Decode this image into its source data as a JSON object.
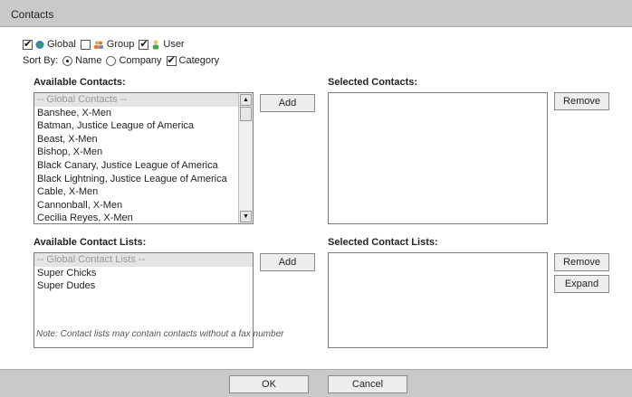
{
  "window": {
    "title": "Contacts"
  },
  "filters": {
    "global": {
      "label": "Global",
      "checked": true,
      "icon": "globe-icon"
    },
    "group": {
      "label": "Group",
      "checked": false,
      "icon": "group-icon"
    },
    "user": {
      "label": "User",
      "checked": true,
      "icon": "user-icon"
    }
  },
  "sort": {
    "label": "Sort By:",
    "options": [
      {
        "label": "Name",
        "type": "radio",
        "checked": true
      },
      {
        "label": "Company",
        "type": "radio",
        "checked": false
      },
      {
        "label": "Category",
        "type": "checkbox",
        "checked": true
      }
    ]
  },
  "available_contacts": {
    "label": "Available Contacts:",
    "items": [
      "-- Global Contacts --",
      "Banshee, X-Men",
      "Batman, Justice League of America",
      "Beast, X-Men",
      "Bishop, X-Men",
      "Black Canary, Justice League of America",
      "Black Lightning, Justice League of America",
      "Cable, X-Men",
      "Cannonball, X-Men",
      "Cecilia Reyes, X-Men"
    ],
    "add_label": "Add"
  },
  "selected_contacts": {
    "label": "Selected Contacts:",
    "items": [],
    "remove_label": "Remove"
  },
  "available_lists": {
    "label": "Available Contact Lists:",
    "items": [
      "-- Global Contact Lists --",
      "Super Chicks",
      "Super Dudes"
    ],
    "add_label": "Add"
  },
  "selected_lists": {
    "label": "Selected Contact Lists:",
    "items": [],
    "remove_label": "Remove",
    "expand_label": "Expand"
  },
  "note": "Note: Contact lists may contain contacts without a fax number",
  "footer": {
    "ok_label": "OK",
    "cancel_label": "Cancel"
  },
  "colors": {
    "titlebar": "#c9c9c9",
    "list_header_bg": "#e4e4e4",
    "list_header_text": "#9a9a9a",
    "button_bg": "#eeeeee"
  }
}
